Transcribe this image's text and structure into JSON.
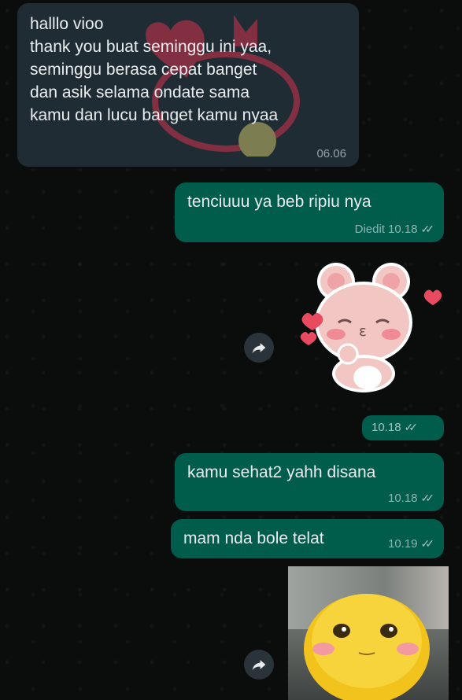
{
  "messages": [
    {
      "id": "m1",
      "direction": "incoming",
      "text": "halllo vioo\nthank you buat seminggu ini yaa,\nseminggu berasa cepat banget\ndan asik selama ondate sama\nkamu dan lucu banget kamu nyaa",
      "time": "06.06"
    },
    {
      "id": "m2",
      "direction": "outgoing",
      "text": "tenciuuu ya beb ripiu nya",
      "edited": "Diedit",
      "time": "10.18"
    },
    {
      "id": "m3",
      "direction": "outgoing",
      "type": "sticker",
      "sticker": "bear-kiss-sticker",
      "time": "10.18"
    },
    {
      "id": "m4",
      "direction": "outgoing",
      "text": "kamu sehat2 yahh disana",
      "time": "10.18"
    },
    {
      "id": "m5",
      "direction": "outgoing",
      "text": "mam nda bole telat",
      "time": "10.19"
    },
    {
      "id": "m6",
      "direction": "outgoing",
      "type": "photo",
      "photo": "yellow-blob-character"
    }
  ],
  "colors": {
    "incoming": "#1f2c34",
    "outgoing": "#005c4b",
    "background": "#0b0d0c",
    "text": "#e9edef"
  },
  "icons": {
    "forward": "forward-arrow-icon",
    "read_receipt": "double-check-icon"
  }
}
